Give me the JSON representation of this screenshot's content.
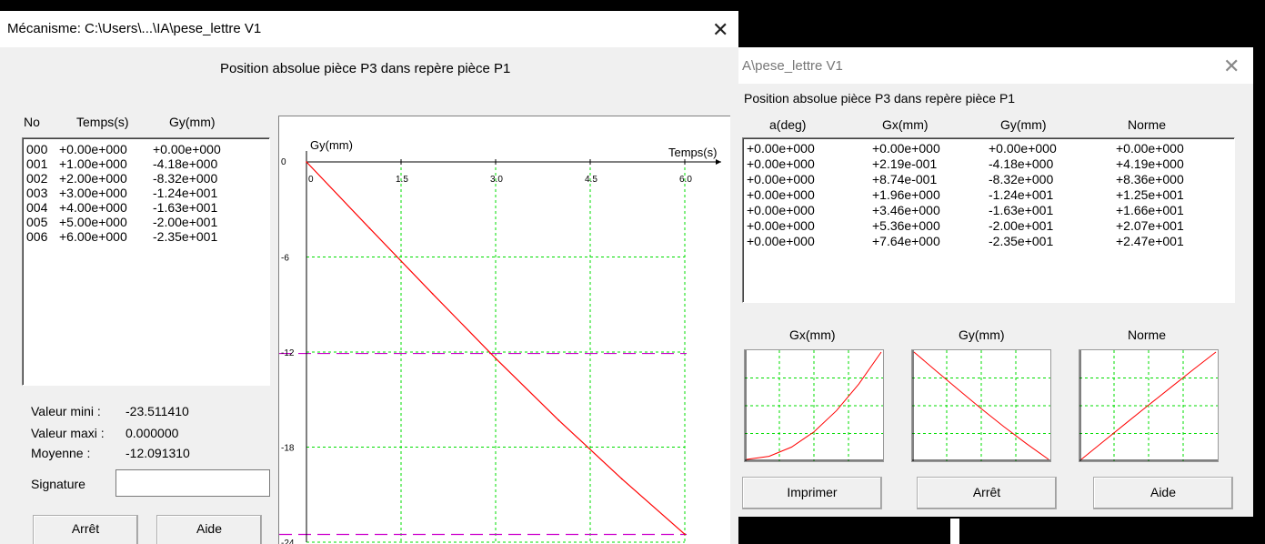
{
  "win1": {
    "title": "Mécanisme: C:\\Users\\...\\IA\\pese_lettre V1",
    "close": "✕",
    "heading": "Position absolue pièce P3 dans repère pièce P1",
    "list_headers": [
      "No",
      "Temps(s)",
      "Gy(mm)"
    ],
    "rows": [
      [
        "000",
        "+0.00e+000",
        "+0.00e+000"
      ],
      [
        "001",
        "+1.00e+000",
        "-4.18e+000"
      ],
      [
        "002",
        "+2.00e+000",
        "-8.32e+000"
      ],
      [
        "003",
        "+3.00e+000",
        "-1.24e+001"
      ],
      [
        "004",
        "+4.00e+000",
        "-1.63e+001"
      ],
      [
        "005",
        "+5.00e+000",
        "-2.00e+001"
      ],
      [
        "006",
        "+6.00e+000",
        "-2.35e+001"
      ]
    ],
    "stats": {
      "min_label": "Valeur mini :",
      "min_value": "-23.511410",
      "max_label": "Valeur maxi :",
      "max_value": "0.000000",
      "mean_label": "Moyenne :",
      "mean_value": "-12.091310"
    },
    "signature_label": "Signature",
    "signature_value": "",
    "stop_button": "Arrêt",
    "help_button": "Aide"
  },
  "win2": {
    "title": "A\\pese_lettre V1",
    "close": "✕",
    "heading": "Position absolue pièce P3 dans repère pièce P1",
    "columns": [
      "a(deg)",
      "Gx(mm)",
      "Gy(mm)",
      "Norme"
    ],
    "rows": [
      [
        "+0.00e+000",
        "+0.00e+000",
        "+0.00e+000",
        "+0.00e+000"
      ],
      [
        "+0.00e+000",
        "+2.19e-001",
        "-4.18e+000",
        "+4.19e+000"
      ],
      [
        "+0.00e+000",
        "+8.74e-001",
        "-8.32e+000",
        "+8.36e+000"
      ],
      [
        "+0.00e+000",
        "+1.96e+000",
        "-1.24e+001",
        "+1.25e+001"
      ],
      [
        "+0.00e+000",
        "+3.46e+000",
        "-1.63e+001",
        "+1.66e+001"
      ],
      [
        "+0.00e+000",
        "+5.36e+000",
        "-2.00e+001",
        "+2.07e+001"
      ],
      [
        "+0.00e+000",
        "+7.64e+000",
        "-2.35e+001",
        "+2.47e+001"
      ]
    ],
    "mini_titles": [
      "Gx(mm)",
      "Gy(mm)",
      "Norme"
    ],
    "print_button": "Imprimer",
    "stop_button": "Arrêt",
    "help_button": "Aide"
  },
  "colors": {
    "curve": "#ff0000",
    "grid": "#00dd00",
    "limit_lines": "#cc00cc",
    "window_bg": "#f0f0f0"
  },
  "chart_data": {
    "type": "line",
    "title": "",
    "xlabel": "Temps(s)",
    "ylabel": "Gy(mm)",
    "x_ticks": [
      "1.5",
      "3.0",
      "4.5",
      "6.0"
    ],
    "x_origin_label": "0",
    "y_ticks": [
      "0",
      "-6",
      "-12",
      "-18",
      "-24"
    ],
    "xlim": [
      0,
      6
    ],
    "ylim": [
      -24,
      0
    ],
    "grid": true,
    "x": [
      0,
      1,
      2,
      3,
      4,
      5,
      6
    ],
    "series": [
      {
        "values": [
          0,
          -4.18,
          -8.32,
          -12.4,
          -16.3,
          -20.0,
          -23.5
        ]
      }
    ],
    "reference_lines": [
      -12.09,
      -23.51
    ],
    "mini_charts": [
      {
        "name": "Gx(mm)",
        "values": [
          0,
          0.219,
          0.874,
          1.96,
          3.46,
          5.36,
          7.64
        ]
      },
      {
        "name": "Gy(mm)",
        "values": [
          0,
          -4.18,
          -8.32,
          -12.4,
          -16.3,
          -20.0,
          -23.5
        ]
      },
      {
        "name": "Norme",
        "values": [
          0,
          4.19,
          8.36,
          12.5,
          16.6,
          20.7,
          24.7
        ]
      }
    ]
  }
}
